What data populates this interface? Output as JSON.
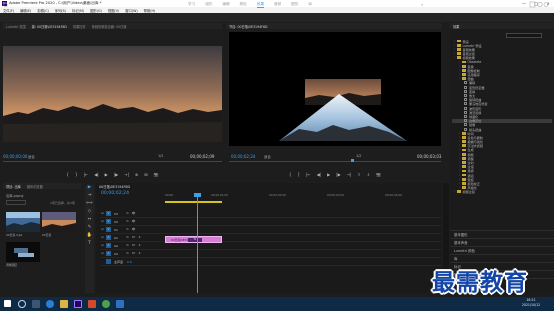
{
  "window": {
    "title": "Adobe Premiere Pro 2020 - C:\\用户\\Video\\桌面\\出库 *",
    "minimize": "—",
    "maximize": "□",
    "close": "✕"
  },
  "menu": [
    "文件(F)",
    "编辑(E)",
    "剪辑(C)",
    "序列(S)",
    "标记(M)",
    "图形(G)",
    "视图(V)",
    "窗口(W)",
    "帮助(H)"
  ],
  "workspaces": {
    "tabs": [
      "学习",
      "组件",
      "编辑",
      "颜色",
      "效果",
      "音频",
      "图形",
      "库"
    ],
    "active": "效果",
    "more": "»"
  },
  "source_monitor": {
    "tabs": [
      "Lumetri 范围",
      "源: 00日落\\0E3194F6D",
      "效果控件",
      "音频剪辑混合器: 00日落"
    ],
    "timecode": "00;00;00;00",
    "fit": "适合",
    "resolution": "1/2",
    "duration": "00;00;02;09",
    "controls": [
      "{",
      "}",
      "|←",
      "◀|",
      "▶",
      "|▶",
      "→|",
      "⊕",
      "⊞",
      "📷"
    ]
  },
  "program_monitor": {
    "tabs": [
      "节目: 00日落\\0E3194F6D"
    ],
    "timecode": "00;00;02;24",
    "fit": "适合",
    "resolution": "1/2",
    "duration": "00;00;03;03",
    "controls": [
      "{",
      "}",
      "|←",
      "◀|",
      "▶",
      "|▶",
      "→|",
      "⇪",
      "⇩",
      "📷"
    ]
  },
  "effects_panel": {
    "title": "效果",
    "tree": [
      {
        "label": "预设",
        "indent": 0,
        "kind": "folder"
      },
      {
        "label": "Lumetri 预设",
        "indent": 0,
        "kind": "folder"
      },
      {
        "label": "音频效果",
        "indent": 0,
        "kind": "folder"
      },
      {
        "label": "音频过渡",
        "indent": 0,
        "kind": "folder"
      },
      {
        "label": "视频效果",
        "indent": 0,
        "kind": "folder"
      },
      {
        "label": "Obsolete",
        "indent": 1,
        "kind": "folder"
      },
      {
        "label": "变换",
        "indent": 1,
        "kind": "folder"
      },
      {
        "label": "图像控制",
        "indent": 1,
        "kind": "folder"
      },
      {
        "label": "实用程序",
        "indent": 1,
        "kind": "folder"
      },
      {
        "label": "扭曲",
        "indent": 1,
        "kind": "folder"
      },
      {
        "label": "偏移",
        "indent": 2,
        "kind": "fx"
      },
      {
        "label": "变形稳定器",
        "indent": 2,
        "kind": "fx"
      },
      {
        "label": "变换",
        "indent": 2,
        "kind": "fx"
      },
      {
        "label": "放大",
        "indent": 2,
        "kind": "fx"
      },
      {
        "label": "旋转扭曲",
        "indent": 2,
        "kind": "fx"
      },
      {
        "label": "果冻效应修复",
        "indent": 2,
        "kind": "fx"
      },
      {
        "label": "波形变形",
        "indent": 2,
        "kind": "fx"
      },
      {
        "label": "湍流置换",
        "indent": 2,
        "kind": "fx"
      },
      {
        "label": "球面化",
        "indent": 2,
        "kind": "fx"
      },
      {
        "label": "边角定位",
        "indent": 2,
        "kind": "fx",
        "selected": true
      },
      {
        "label": "镜像",
        "indent": 2,
        "kind": "fx"
      },
      {
        "label": "镜头扭曲",
        "indent": 2,
        "kind": "fx"
      },
      {
        "label": "时间",
        "indent": 1,
        "kind": "folder"
      },
      {
        "label": "杂色与颗粒",
        "indent": 1,
        "kind": "folder"
      },
      {
        "label": "模糊与锐化",
        "indent": 1,
        "kind": "folder"
      },
      {
        "label": "沉浸式视频",
        "indent": 1,
        "kind": "folder"
      },
      {
        "label": "生成",
        "indent": 1,
        "kind": "folder"
      },
      {
        "label": "视频",
        "indent": 1,
        "kind": "folder"
      },
      {
        "label": "调整",
        "indent": 1,
        "kind": "folder"
      },
      {
        "label": "过时",
        "indent": 1,
        "kind": "folder"
      },
      {
        "label": "过渡",
        "indent": 1,
        "kind": "folder"
      },
      {
        "label": "透视",
        "indent": 1,
        "kind": "folder"
      },
      {
        "label": "通道",
        "indent": 1,
        "kind": "folder"
      },
      {
        "label": "键控",
        "indent": 1,
        "kind": "folder"
      },
      {
        "label": "颜色校正",
        "indent": 1,
        "kind": "folder"
      },
      {
        "label": "风格化",
        "indent": 1,
        "kind": "folder"
      },
      {
        "label": "视频过渡",
        "indent": 0,
        "kind": "folder"
      }
    ],
    "sections": [
      "基本图形",
      "基本声音",
      "Lumetri 颜色",
      "库",
      "标记",
      "历史记录",
      "信息"
    ]
  },
  "project_panel": {
    "tabs": [
      "项目: 出库",
      "媒体浏览器"
    ],
    "project_file": "出库.prproj",
    "item_count": "1项已选择，共3项",
    "items": [
      {
        "label": "00日落.mp4",
        "duration": "2;09"
      },
      {
        "label": "00日落",
        "duration": "3;03"
      },
      {
        "label": "调整图层",
        "duration": "4;29"
      }
    ]
  },
  "tools": [
    "▶",
    "⇥",
    "⟺",
    "◇",
    "↔",
    "✎",
    "✋",
    "T"
  ],
  "timeline": {
    "tab": "00日落\\0E3194F6D",
    "timecode": "00;00;02;24",
    "ruler": [
      "00;00",
      "00;00;01;00",
      "00;00;02;00",
      "00;00;03;00",
      "00;00;04;00"
    ],
    "tracks": [
      {
        "name": "V3",
        "kind": "video"
      },
      {
        "name": "V2",
        "kind": "video"
      },
      {
        "name": "V1",
        "kind": "video"
      },
      {
        "name": "A1",
        "kind": "audio"
      },
      {
        "name": "A2",
        "kind": "audio"
      },
      {
        "name": "A3",
        "kind": "audio"
      },
      {
        "name": "主声道",
        "kind": "master",
        "value": "0.0"
      }
    ],
    "clip": {
      "label": "00日落\\0E3194F6D",
      "tag": "fx"
    }
  },
  "taskbar": {
    "time": "16:21",
    "date": "2021/10/12"
  },
  "watermark": "最需教育",
  "colors": {
    "accent": "#3d9eea",
    "clip": "#d77fd6",
    "in_out_bar": "#d8c21c",
    "watermark": "#1446a8"
  }
}
